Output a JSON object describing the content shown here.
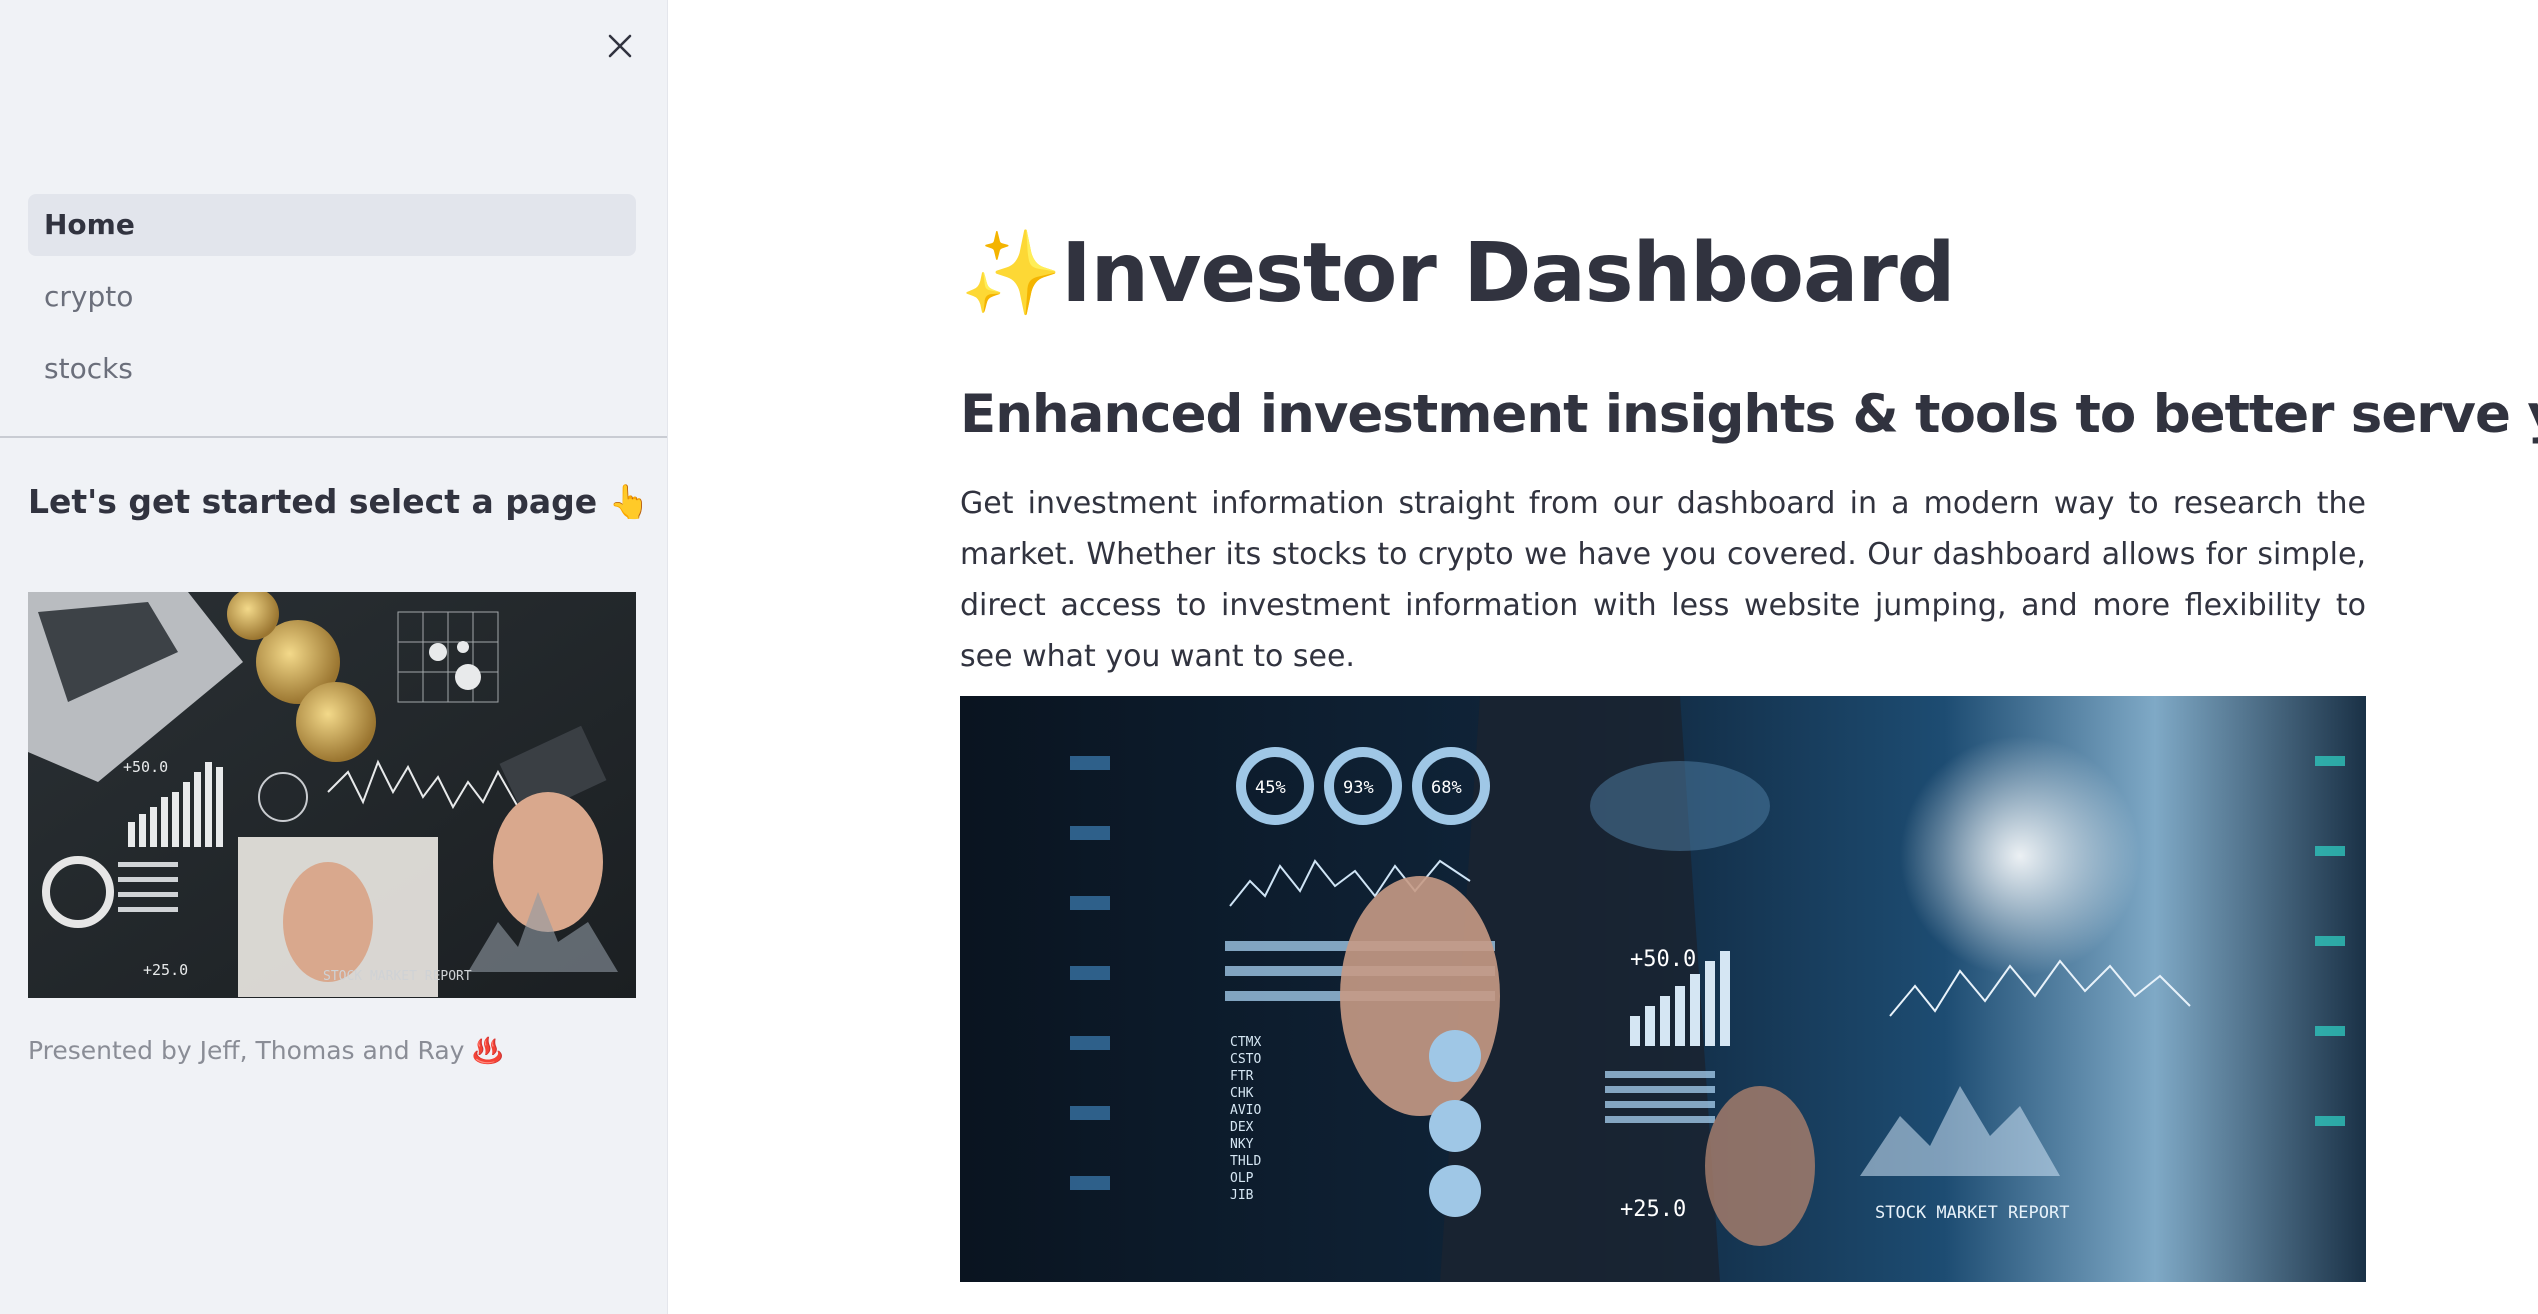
{
  "sidebar": {
    "close_icon": "close-icon",
    "nav": [
      {
        "label": "Home",
        "active": true
      },
      {
        "label": "crypto",
        "active": false
      },
      {
        "label": "stocks",
        "active": false
      }
    ],
    "heading": "Let's get started select a page 👆",
    "image_caption": "Presented by Jeff, Thomas and Ray ♨️",
    "image_text": {
      "plus50": "+50.0",
      "plus25": "+25.0",
      "report": "STOCK MARKET REPORT"
    }
  },
  "main": {
    "title": "✨Investor Dashboard",
    "subtitle": "Enhanced investment insights & tools to better serve you.",
    "intro": "Get investment information straight from our dashboard in a modern way to research the market. Whether its stocks to crypto we have you covered. Our dashboard allows for simple, direct access to investment information with less website jumping, and more flexibility to see what you want to see.",
    "hero_text": {
      "gauge1": "45%",
      "gauge2": "93%",
      "gauge3": "68%",
      "plus50": "+50.0",
      "plus25": "+25.0",
      "report": "STOCK MARKET REPORT",
      "tickers": [
        "CTMX",
        "CSTO",
        "FTR",
        "CHK",
        "AVIO",
        "DEX",
        "NKY",
        "THLD",
        "OLP",
        "JIB"
      ]
    }
  },
  "colors": {
    "sidebar_bg": "#f0f2f6",
    "active_item_bg": "#e2e5ec",
    "text": "#31333f",
    "muted_text": "#6b6f7b"
  }
}
